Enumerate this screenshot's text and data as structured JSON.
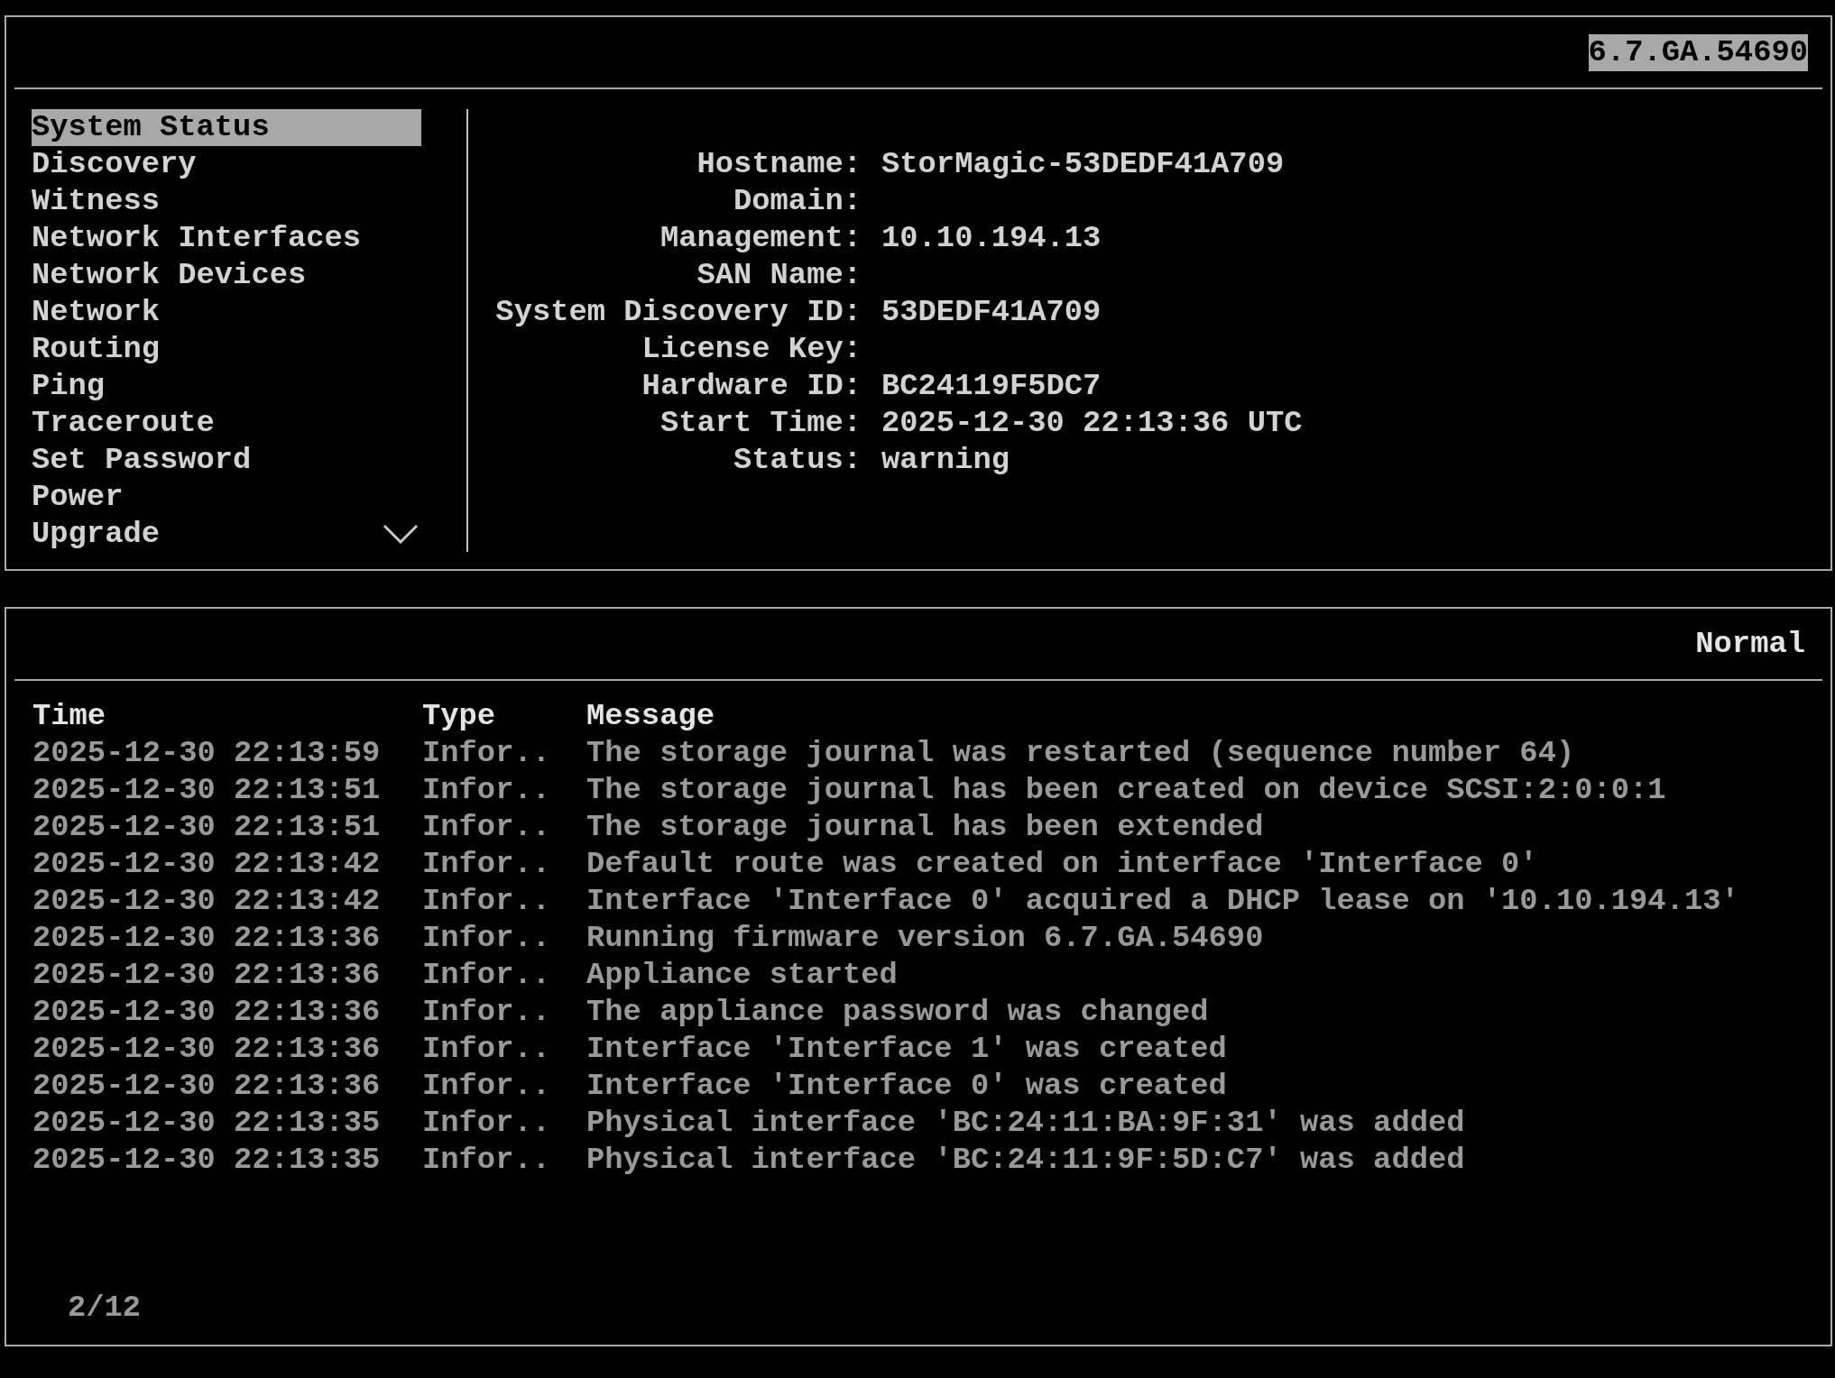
{
  "header": {
    "version": "6.7.GA.54690"
  },
  "menu": {
    "items": [
      {
        "label": "System Status",
        "selected": true
      },
      {
        "label": "Discovery",
        "selected": false
      },
      {
        "label": "Witness",
        "selected": false
      },
      {
        "label": "Network Interfaces",
        "selected": false
      },
      {
        "label": "Network Devices",
        "selected": false
      },
      {
        "label": "Network",
        "selected": false
      },
      {
        "label": "Routing",
        "selected": false
      },
      {
        "label": "Ping",
        "selected": false
      },
      {
        "label": "Traceroute",
        "selected": false
      },
      {
        "label": "Set Password",
        "selected": false
      },
      {
        "label": "Power",
        "selected": false
      },
      {
        "label": "Upgrade",
        "selected": false
      }
    ]
  },
  "system_info": [
    {
      "label": "Hostname:",
      "value": "StorMagic-53DEDF41A709"
    },
    {
      "label": "Domain:"
    },
    {
      "label": "Management:",
      "value": "10.10.194.13"
    },
    {
      "label": "SAN Name:"
    },
    {
      "label": "System Discovery ID:",
      "value": "53DEDF41A709"
    },
    {
      "label": "License Key:"
    },
    {
      "label": "Hardware ID:",
      "value": "BC24119F5DC7"
    },
    {
      "label": "Start Time:",
      "value": "2025-12-30 22:13:36 UTC"
    },
    {
      "label": "Status:",
      "value": "warning"
    }
  ],
  "event_log": {
    "mode": "Normal",
    "columns": [
      "Time",
      "Type",
      "Message"
    ],
    "rows": [
      {
        "time": "2025-12-30 22:13:59",
        "type": "Infor..",
        "message": "The storage journal was restarted (sequence number 64)"
      },
      {
        "time": "2025-12-30 22:13:51",
        "type": "Infor..",
        "message": "The storage journal has been created on device SCSI:2:0:0:1"
      },
      {
        "time": "2025-12-30 22:13:51",
        "type": "Infor..",
        "message": "The storage journal has been extended"
      },
      {
        "time": "2025-12-30 22:13:42",
        "type": "Infor..",
        "message": "Default route was created on interface 'Interface 0'"
      },
      {
        "time": "2025-12-30 22:13:42",
        "type": "Infor..",
        "message": "Interface 'Interface 0' acquired a DHCP lease on '10.10.194.13'"
      },
      {
        "time": "2025-12-30 22:13:36",
        "type": "Infor..",
        "message": "Running firmware version 6.7.GA.54690"
      },
      {
        "time": "2025-12-30 22:13:36",
        "type": "Infor..",
        "message": "Appliance started"
      },
      {
        "time": "2025-12-30 22:13:36",
        "type": "Infor..",
        "message": "The appliance password was changed"
      },
      {
        "time": "2025-12-30 22:13:36",
        "type": "Infor..",
        "message": "Interface 'Interface 1' was created"
      },
      {
        "time": "2025-12-30 22:13:36",
        "type": "Infor..",
        "message": "Interface 'Interface 0' was created"
      },
      {
        "time": "2025-12-30 22:13:35",
        "type": "Infor..",
        "message": "Physical interface 'BC:24:11:BA:9F:31' was added"
      },
      {
        "time": "2025-12-30 22:13:35",
        "type": "Infor..",
        "message": "Physical interface 'BC:24:11:9F:5D:C7' was added"
      }
    ],
    "position": "2/12"
  }
}
